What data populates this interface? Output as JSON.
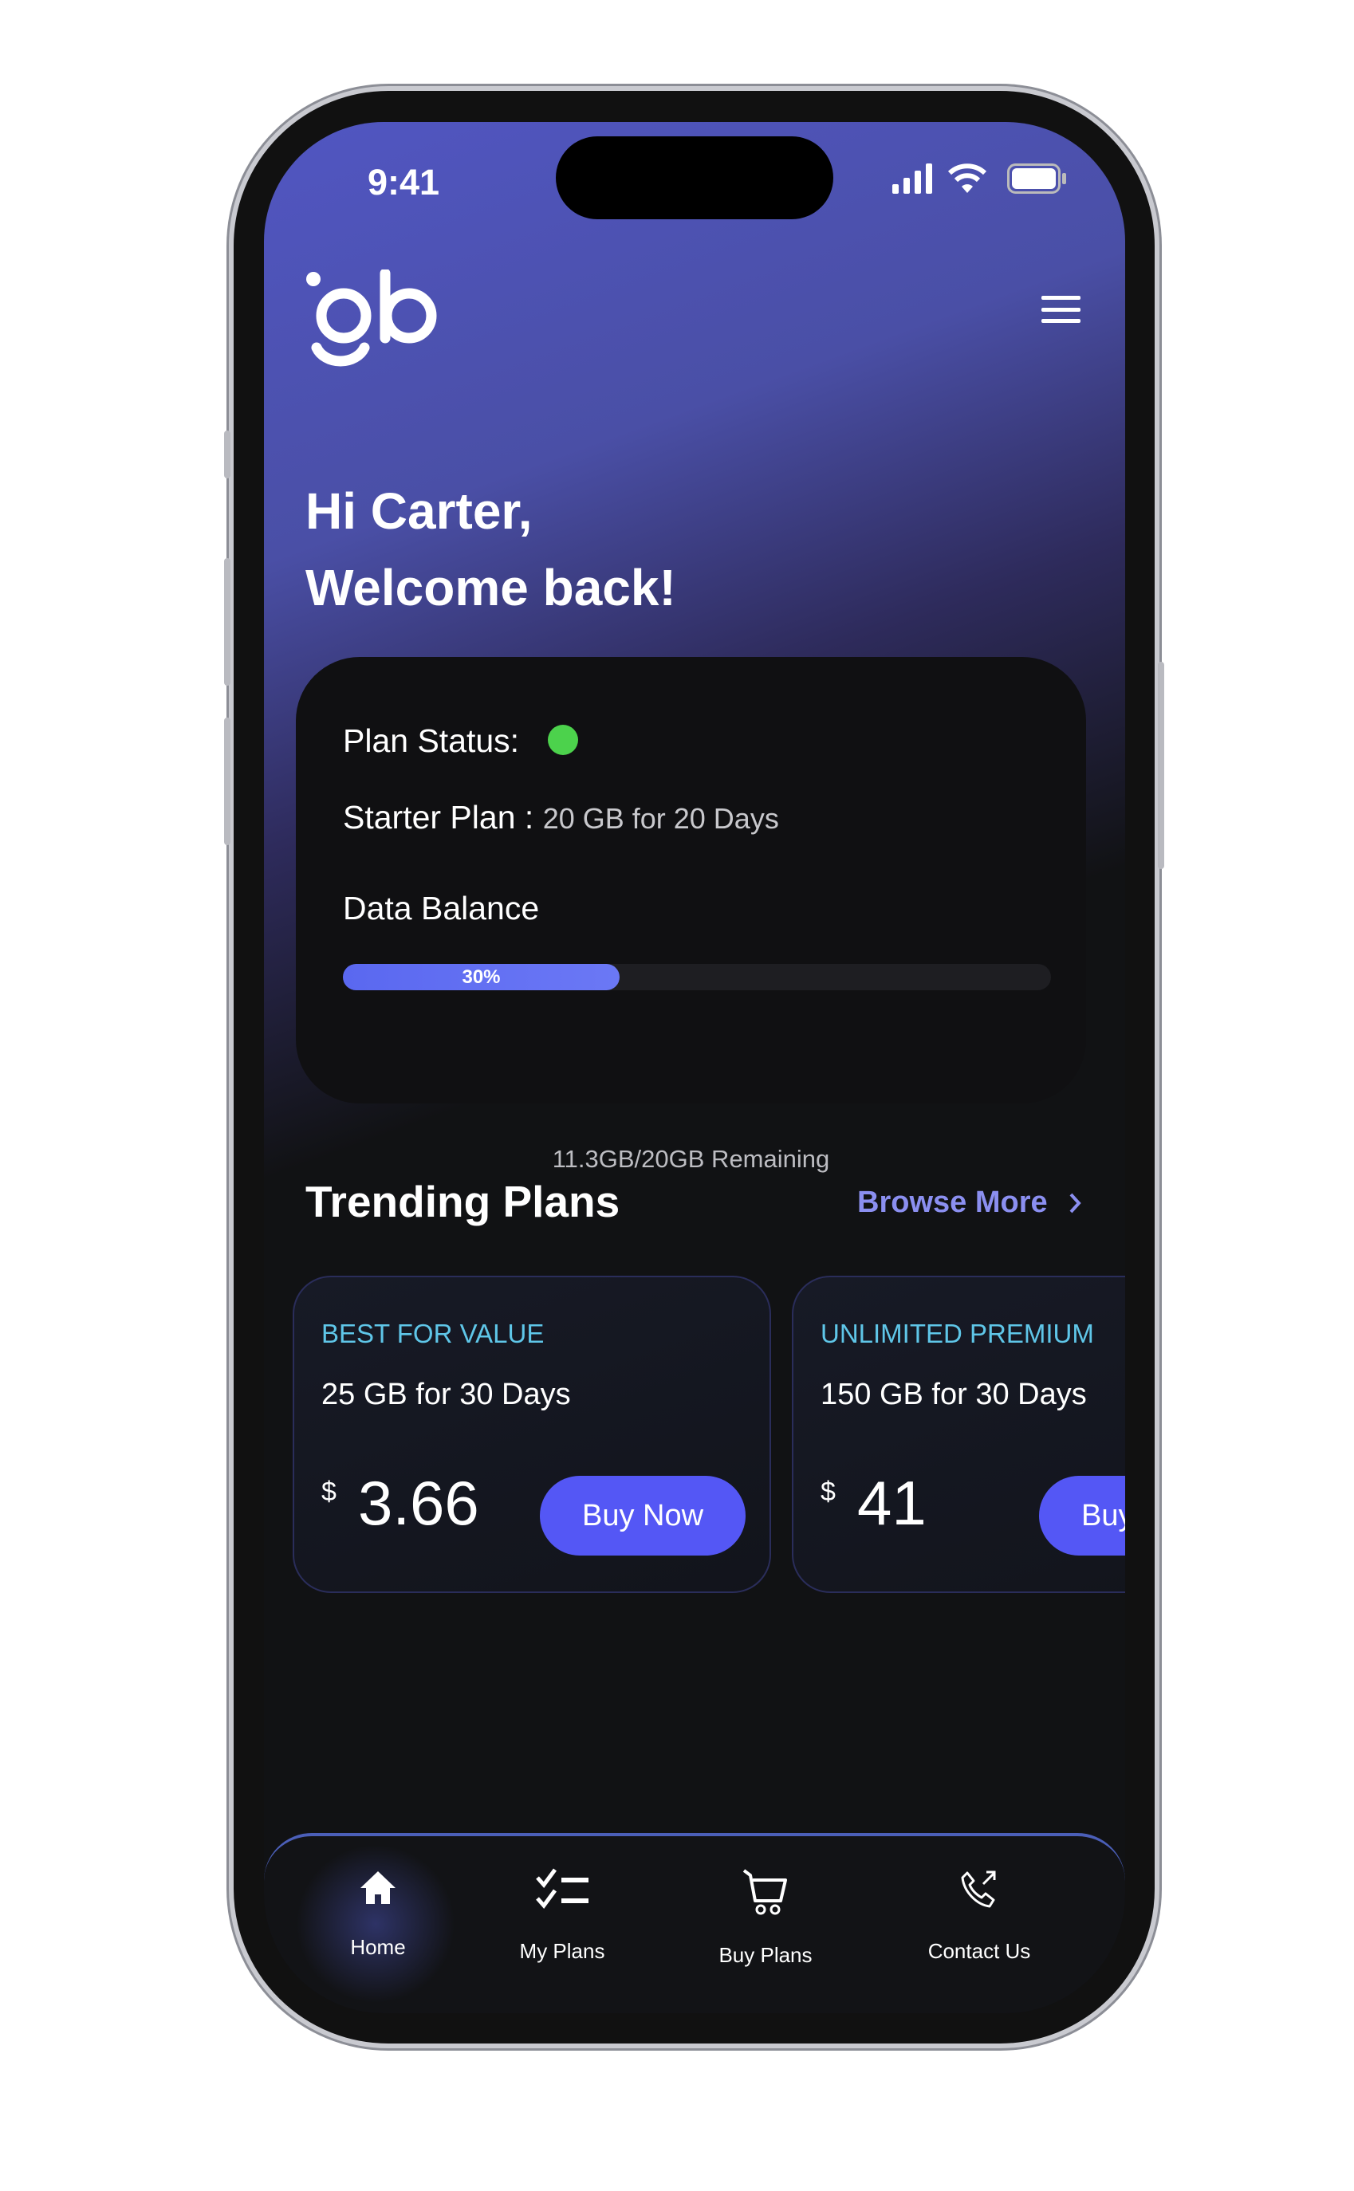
{
  "status_bar": {
    "time": "9:41"
  },
  "header": {
    "logo_text": "gb",
    "menu_icon": "hamburger-icon"
  },
  "greeting": {
    "line1": "Hi Carter,",
    "line2": "Welcome back!"
  },
  "plan_card": {
    "status_label": "Plan Status:",
    "status_color": "#4cd24c",
    "plan_name": "Starter Plan :",
    "plan_detail": "20 GB for 20 Days",
    "balance_label": "Data Balance",
    "progress_percent": 30,
    "progress_label": "30%",
    "remaining": "11.3GB/20GB  Remaining"
  },
  "trending": {
    "title": "Trending Plans",
    "browse_more": "Browse More",
    "plans": [
      {
        "tag": "BEST FOR VALUE",
        "desc": "25 GB for 30 Days",
        "currency": "$",
        "price": "3.66",
        "button": "Buy Now"
      },
      {
        "tag": "UNLIMITED PREMIUM",
        "desc": "150 GB for 30 Days",
        "currency": "$",
        "price": "41",
        "button": "Buy Now"
      }
    ]
  },
  "nav": {
    "items": [
      {
        "label": "Home",
        "icon": "home-icon"
      },
      {
        "label": "My Plans",
        "icon": "checklist-icon"
      },
      {
        "label": "Buy Plans",
        "icon": "cart-icon"
      },
      {
        "label": "Contact Us",
        "icon": "phone-icon"
      }
    ]
  },
  "colors": {
    "accent": "#5457f5",
    "tag": "#5fc6e8",
    "link": "#8b8ff0"
  }
}
